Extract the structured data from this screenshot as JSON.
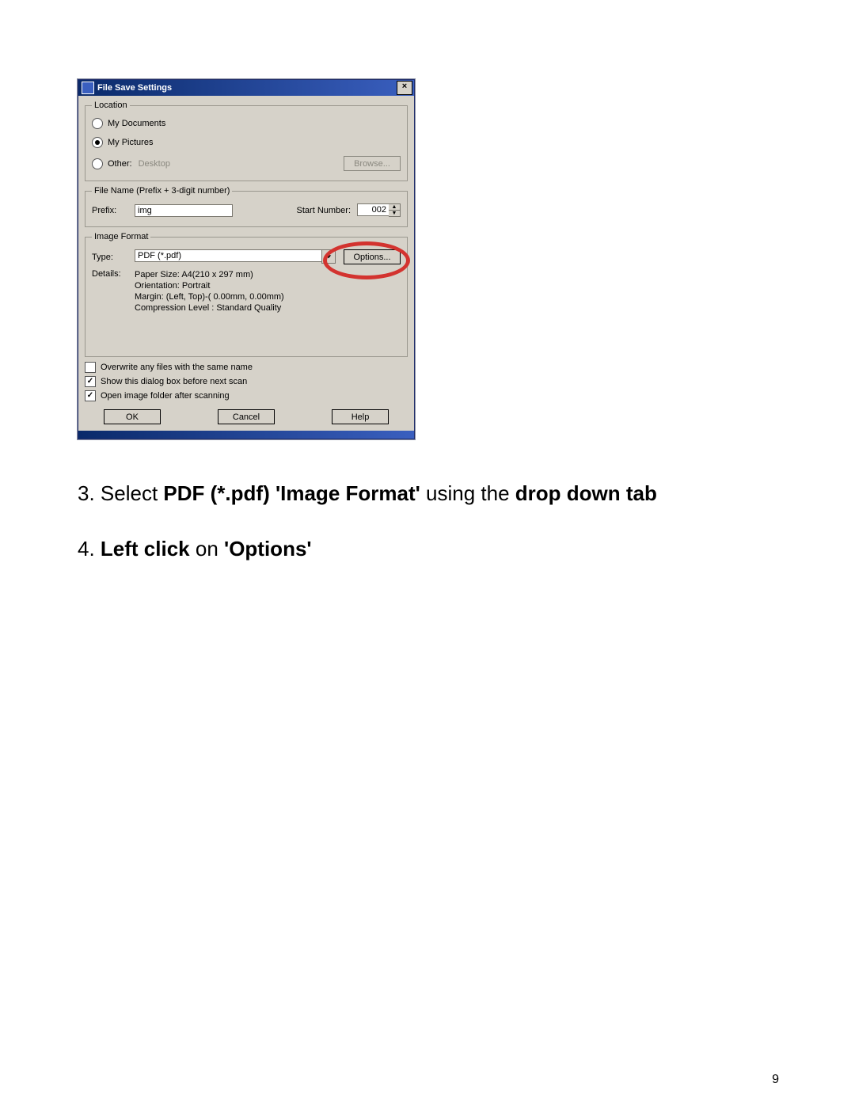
{
  "dialog": {
    "title": "File Save Settings",
    "location": {
      "legend": "Location",
      "opt_my_documents": "My Documents",
      "opt_my_pictures": "My Pictures",
      "opt_other": "Other:",
      "other_value": "Desktop",
      "browse": "Browse..."
    },
    "filename": {
      "legend": "File Name (Prefix + 3-digit number)",
      "prefix_label": "Prefix:",
      "prefix_value": "img",
      "start_label": "Start Number:",
      "start_value": "002"
    },
    "imageformat": {
      "legend": "Image Format",
      "type_label": "Type:",
      "type_value": "PDF (*.pdf)",
      "options": "Options...",
      "details_label": "Details:",
      "details_line1": "Paper Size: A4(210 x 297 mm)",
      "details_line2": "Orientation: Portrait",
      "details_line3": "Margin: (Left, Top)-( 0.00mm, 0.00mm)",
      "details_line4": "Compression Level : Standard Quality"
    },
    "checks": {
      "overwrite": "Overwrite any files with the same name",
      "showdialog": "Show this dialog box before next scan",
      "openfolder": "Open image folder after scanning"
    },
    "buttons": {
      "ok": "OK",
      "cancel": "Cancel",
      "help": "Help"
    }
  },
  "instructions": {
    "step3_num": "3. ",
    "step3_a": "Select ",
    "step3_b": "PDF (*.pdf) 'Image Format'",
    "step3_c": " using the ",
    "step3_d": "drop down tab",
    "step4_num": "4. ",
    "step4_a": "Left click",
    "step4_b": " on ",
    "step4_c": "'Options'"
  },
  "page_number": "9"
}
